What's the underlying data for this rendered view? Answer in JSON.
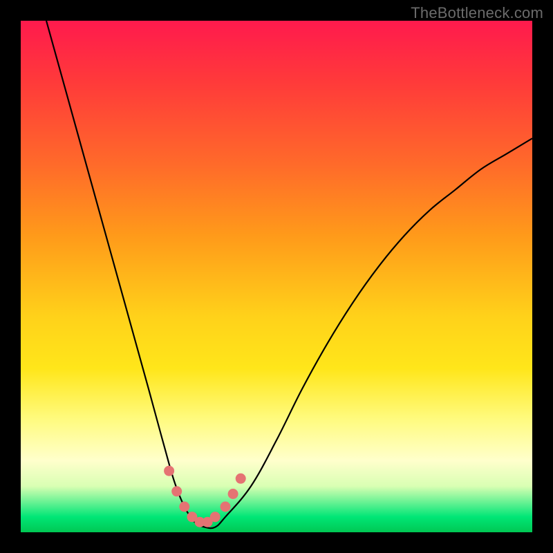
{
  "watermark": "TheBottleneck.com",
  "chart_data": {
    "type": "line",
    "title": "",
    "xlabel": "",
    "ylabel": "",
    "xlim": [
      0,
      100
    ],
    "ylim": [
      0,
      100
    ],
    "series": [
      {
        "name": "curve",
        "x": [
          5,
          10,
          15,
          20,
          25,
          28,
          30,
          32,
          34,
          36,
          38,
          40,
          45,
          50,
          55,
          60,
          65,
          70,
          75,
          80,
          85,
          90,
          95,
          100
        ],
        "values": [
          100,
          82,
          64,
          46,
          28,
          17,
          10,
          5,
          2,
          1,
          1,
          3,
          9,
          18,
          28,
          37,
          45,
          52,
          58,
          63,
          67,
          71,
          74,
          77
        ]
      }
    ],
    "markers": {
      "name": "dots",
      "x": [
        29.0,
        30.5,
        32.0,
        33.5,
        35.0,
        36.5,
        38.0,
        40.0,
        41.5,
        43.0
      ],
      "values": [
        12.0,
        8.0,
        5.0,
        3.0,
        2.0,
        2.0,
        3.0,
        5.0,
        7.5,
        10.5
      ]
    }
  }
}
